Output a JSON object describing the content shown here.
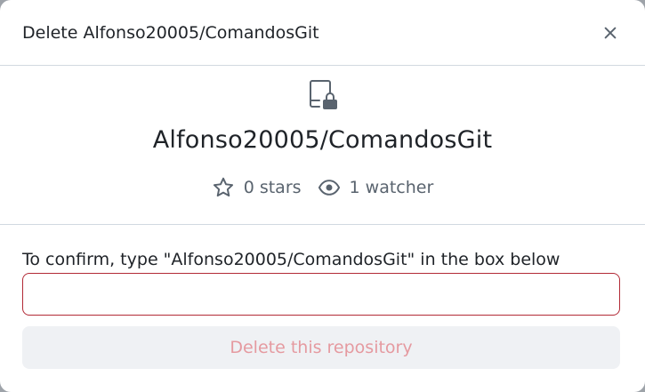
{
  "dialog": {
    "title": "Delete Alfonso20005/ComandosGit",
    "close_icon": "x-icon"
  },
  "repo": {
    "icon": "repo-locked-icon",
    "name": "Alfonso20005/ComandosGit",
    "stars_label": "0 stars",
    "stars_icon": "star-icon",
    "watchers_label": "1 watcher",
    "watchers_icon": "eye-icon"
  },
  "confirm": {
    "label": "To confirm, type \"Alfonso20005/ComandosGit\" in the box below",
    "input_value": "",
    "delete_button_label": "Delete this repository"
  },
  "colors": {
    "danger_border": "#b22a36",
    "danger_text_disabled": "#e59aa0",
    "muted_text": "#59636e",
    "text": "#1f2328",
    "divider": "#d1d9e0",
    "button_bg_disabled": "#eff1f4"
  }
}
